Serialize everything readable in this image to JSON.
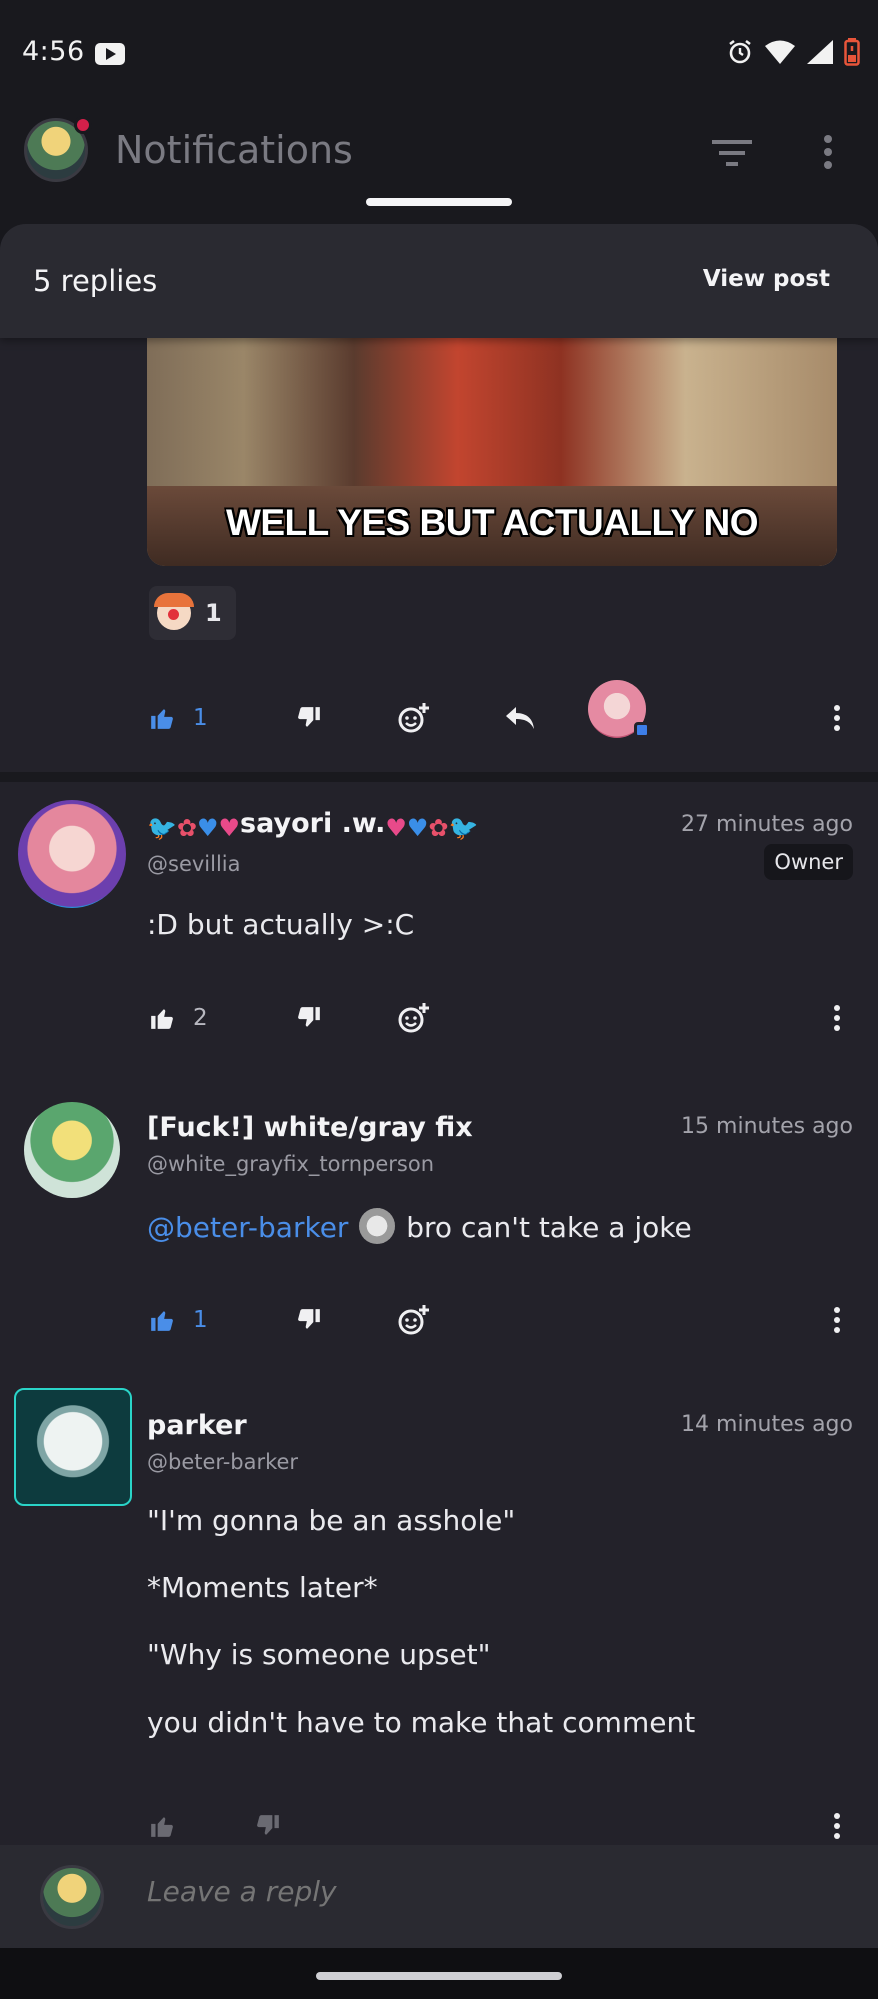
{
  "status_bar": {
    "time": "4:56",
    "icons": [
      "youtube-icon",
      "alarm-icon",
      "wifi-icon",
      "signal-icon",
      "battery-icon"
    ]
  },
  "app_header": {
    "title": "Notifications"
  },
  "sheet": {
    "title": "5 replies",
    "view_post": "View post"
  },
  "first_comment": {
    "gif_caption": "WELL YES BUT ACTUALLY NO",
    "reaction": {
      "emoji": "clown-face",
      "count": "1"
    },
    "upvotes": "1"
  },
  "comments": [
    {
      "name_text": "sayori .w.",
      "handle": "@sevillia",
      "time": "27 minutes ago",
      "badge": "Owner",
      "body": [
        ":D but actually >:C"
      ],
      "upvotes": "2"
    },
    {
      "name_text": "[Fuck!] white/gray fix",
      "handle": "@white_grayfix_tornperson",
      "time": "15 minutes ago",
      "mention": "@beter-barker",
      "body": [
        "bro can't take a joke"
      ],
      "upvotes": "1"
    },
    {
      "name_text": "parker",
      "handle": "@beter-barker",
      "time": "14 minutes ago",
      "body": [
        "\"I'm gonna be an asshole\"",
        "*Moments later*",
        "\"Why is someone upset\"",
        "you didn't have to make that comment"
      ]
    }
  ],
  "reply_bar": {
    "placeholder": "Leave a reply"
  },
  "colors": {
    "accent": "#4a8ee8",
    "sheet_bg": "#23222a",
    "header_bg": "#2a2a31",
    "app_bg": "#19191e",
    "notification_dot": "#d4204a"
  }
}
